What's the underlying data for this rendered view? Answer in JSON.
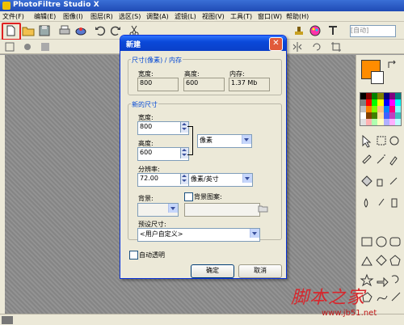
{
  "app": {
    "title": "PhotoFiltre Studio X"
  },
  "menu": [
    "文件(F)",
    "编辑(E)",
    "图像(I)",
    "图层(R)",
    "选区(S)",
    "调整(A)",
    "滤镜(L)",
    "视图(V)",
    "工具(T)",
    "窗口(W)",
    "帮助(H)"
  ],
  "toolbar": {
    "zoom_placeholder": "[自动]"
  },
  "dialog": {
    "title": "新建",
    "size_group_label": "尺寸(像素) / 内存",
    "width_label": "宽度:",
    "height_label": "高度:",
    "memory_label": "内存:",
    "cur_width": "800",
    "cur_height": "600",
    "memory_value": "1.37 Mb",
    "new_size_label": "新的尺寸",
    "new_width_label": "宽度:",
    "new_width": "800",
    "new_height_label": "高度:",
    "new_height": "600",
    "unit": "像素",
    "resolution_label": "分辨率:",
    "resolution": "72.00",
    "resolution_unit": "像素/英寸",
    "background_label": "背景:",
    "bg_pattern_label": "背景图案:",
    "preset_label": "预设尺寸:",
    "preset_value": "<用户自定义>",
    "auto_transparent_label": "自动透明",
    "ok": "确定",
    "cancel": "取消"
  },
  "watermark": {
    "brand": "脚本之家",
    "url": "www.jb51.net"
  },
  "colors": {
    "foreground": "#ff8c00",
    "background": "#ffffff",
    "accent": "#0a49d9"
  }
}
